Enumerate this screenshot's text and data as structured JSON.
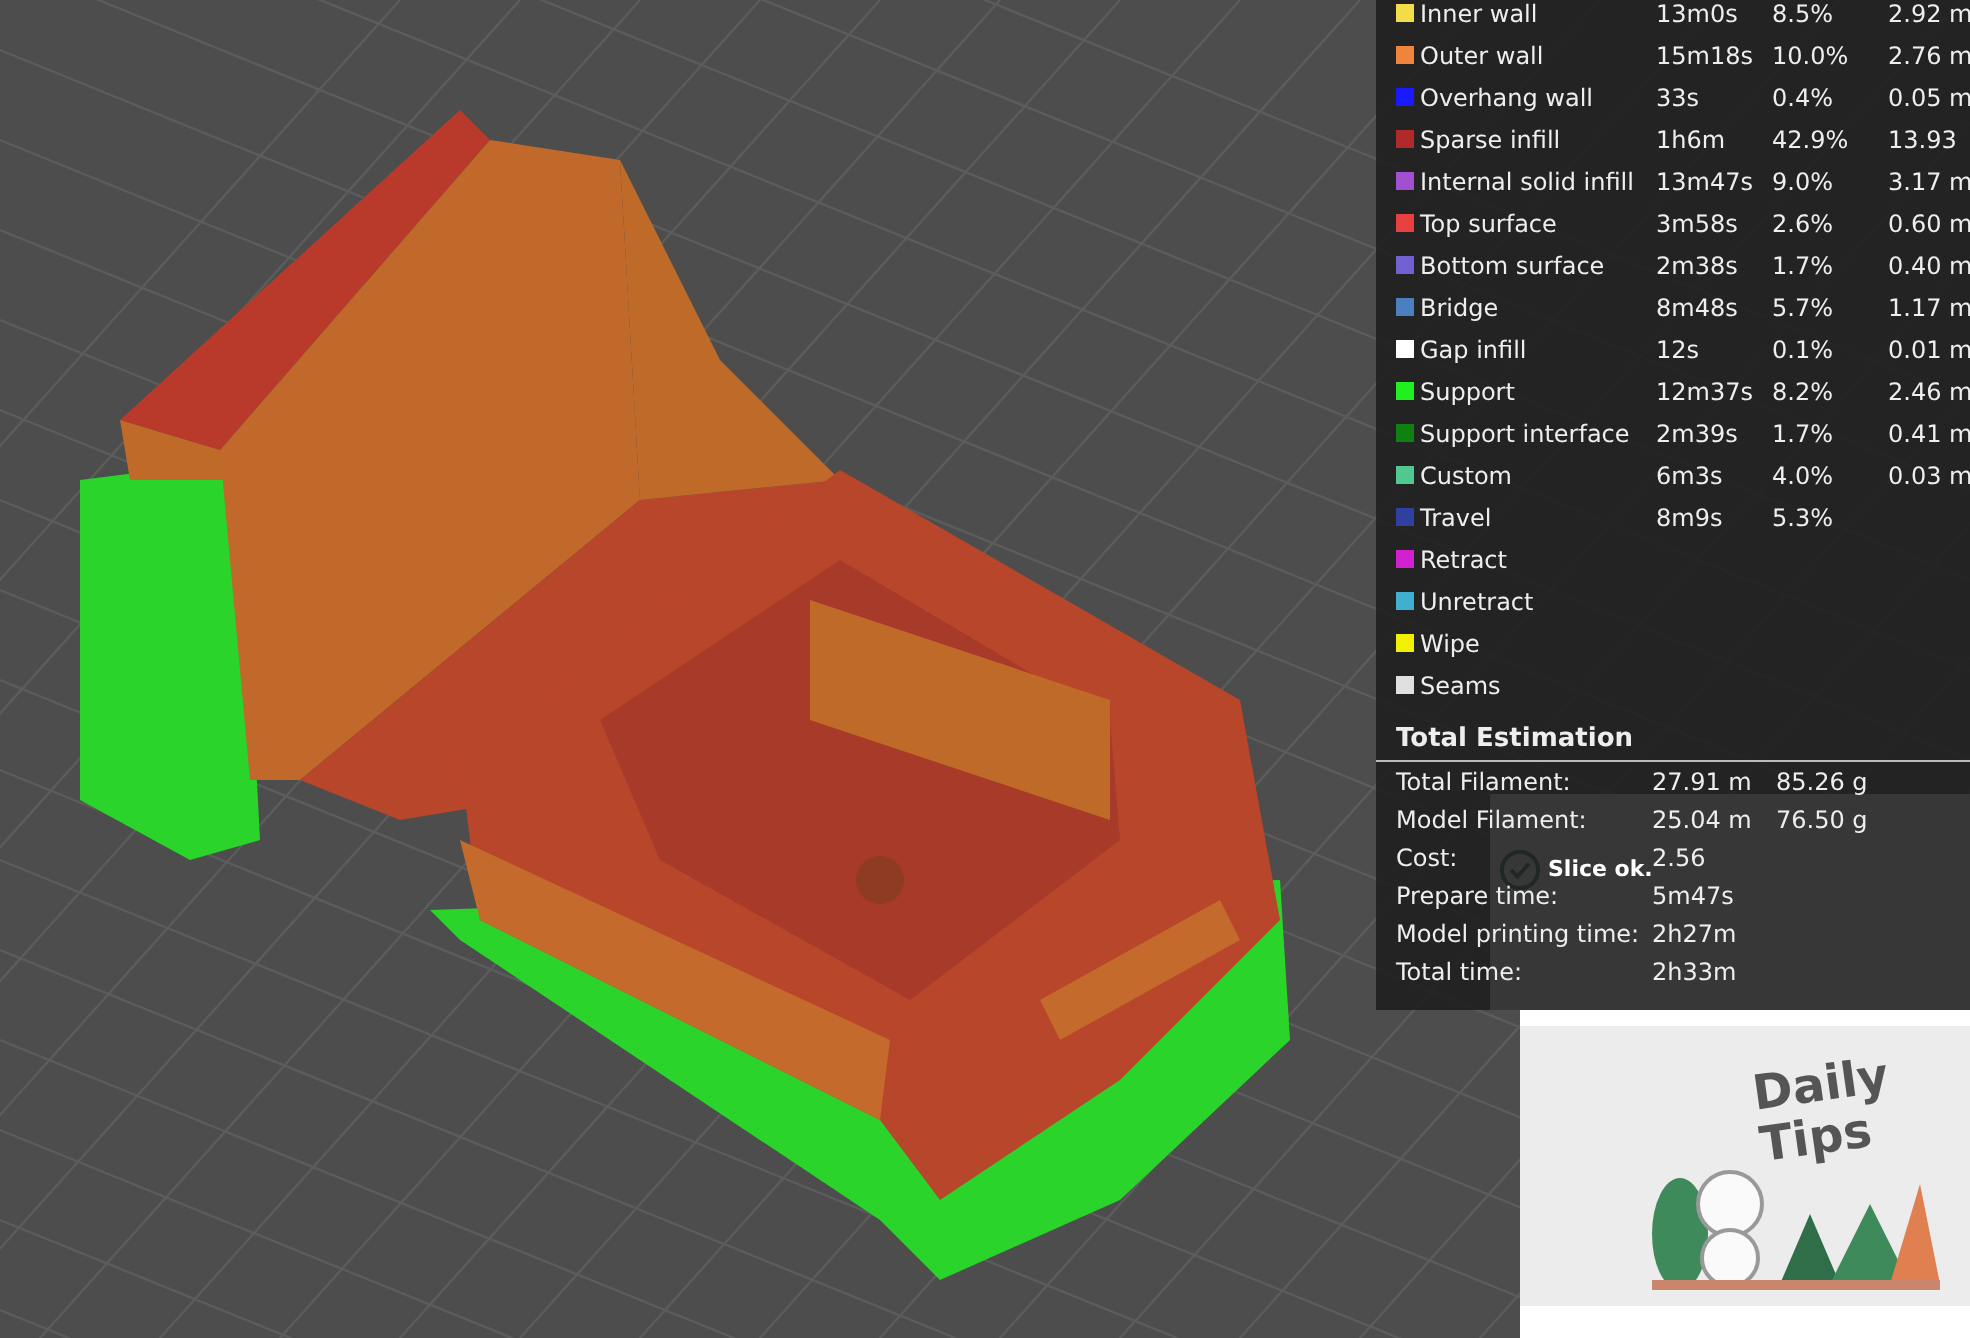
{
  "legend": {
    "rows": [
      {
        "name": "Inner wall",
        "time": "13m0s",
        "percent": "8.5%",
        "length": "2.92 m",
        "color": "#f2dc4a"
      },
      {
        "name": "Outer wall",
        "time": "15m18s",
        "percent": "10.0%",
        "length": "2.76 m",
        "color": "#f0843c"
      },
      {
        "name": "Overhang wall",
        "time": "33s",
        "percent": "0.4%",
        "length": "0.05 m",
        "color": "#1a1aff"
      },
      {
        "name": "Sparse infill",
        "time": "1h6m",
        "percent": "42.9%",
        "length": "13.93",
        "color": "#b02a2a"
      },
      {
        "name": "Internal solid infill",
        "time": "13m47s",
        "percent": "9.0%",
        "length": "3.17 m",
        "color": "#a050d0"
      },
      {
        "name": "Top surface",
        "time": "3m58s",
        "percent": "2.6%",
        "length": "0.60 m",
        "color": "#e84040"
      },
      {
        "name": "Bottom surface",
        "time": "2m38s",
        "percent": "1.7%",
        "length": "0.40 m",
        "color": "#7060d0"
      },
      {
        "name": "Bridge",
        "time": "8m48s",
        "percent": "5.7%",
        "length": "1.17 m",
        "color": "#4a80c0"
      },
      {
        "name": "Gap infill",
        "time": "12s",
        "percent": "0.1%",
        "length": "0.01 m",
        "color": "#ffffff"
      },
      {
        "name": "Support",
        "time": "12m37s",
        "percent": "8.2%",
        "length": "2.46 m",
        "color": "#20f020"
      },
      {
        "name": "Support interface",
        "time": "2m39s",
        "percent": "1.7%",
        "length": "0.41 m",
        "color": "#108010"
      },
      {
        "name": "Custom",
        "time": "6m3s",
        "percent": "4.0%",
        "length": "0.03 m",
        "color": "#50c890"
      },
      {
        "name": "Travel",
        "time": "8m9s",
        "percent": "5.3%",
        "color": "#3040a0"
      },
      {
        "name": "Retract",
        "color": "#d020d0"
      },
      {
        "name": "Unretract",
        "color": "#40b0d0"
      },
      {
        "name": "Wipe",
        "color": "#f0f000"
      },
      {
        "name": "Seams",
        "color": "#e0e0e0"
      }
    ]
  },
  "total_estimation": {
    "title": "Total Estimation",
    "rows": [
      {
        "label": "Total Filament:",
        "value": "27.91 m",
        "weight": "85.26 g"
      },
      {
        "label": "Model Filament:",
        "value": "25.04 m",
        "weight": "76.50 g"
      },
      {
        "label": "Cost:",
        "value": "2.56"
      },
      {
        "label": "Prepare time:",
        "value": "5m47s"
      },
      {
        "label": "Model printing time:",
        "value": "2h27m"
      },
      {
        "label": "Total time:",
        "value": "2h33m"
      }
    ]
  },
  "notification": {
    "message": "Slice ok."
  },
  "daily_tips": {
    "title": "Daily Tips"
  }
}
